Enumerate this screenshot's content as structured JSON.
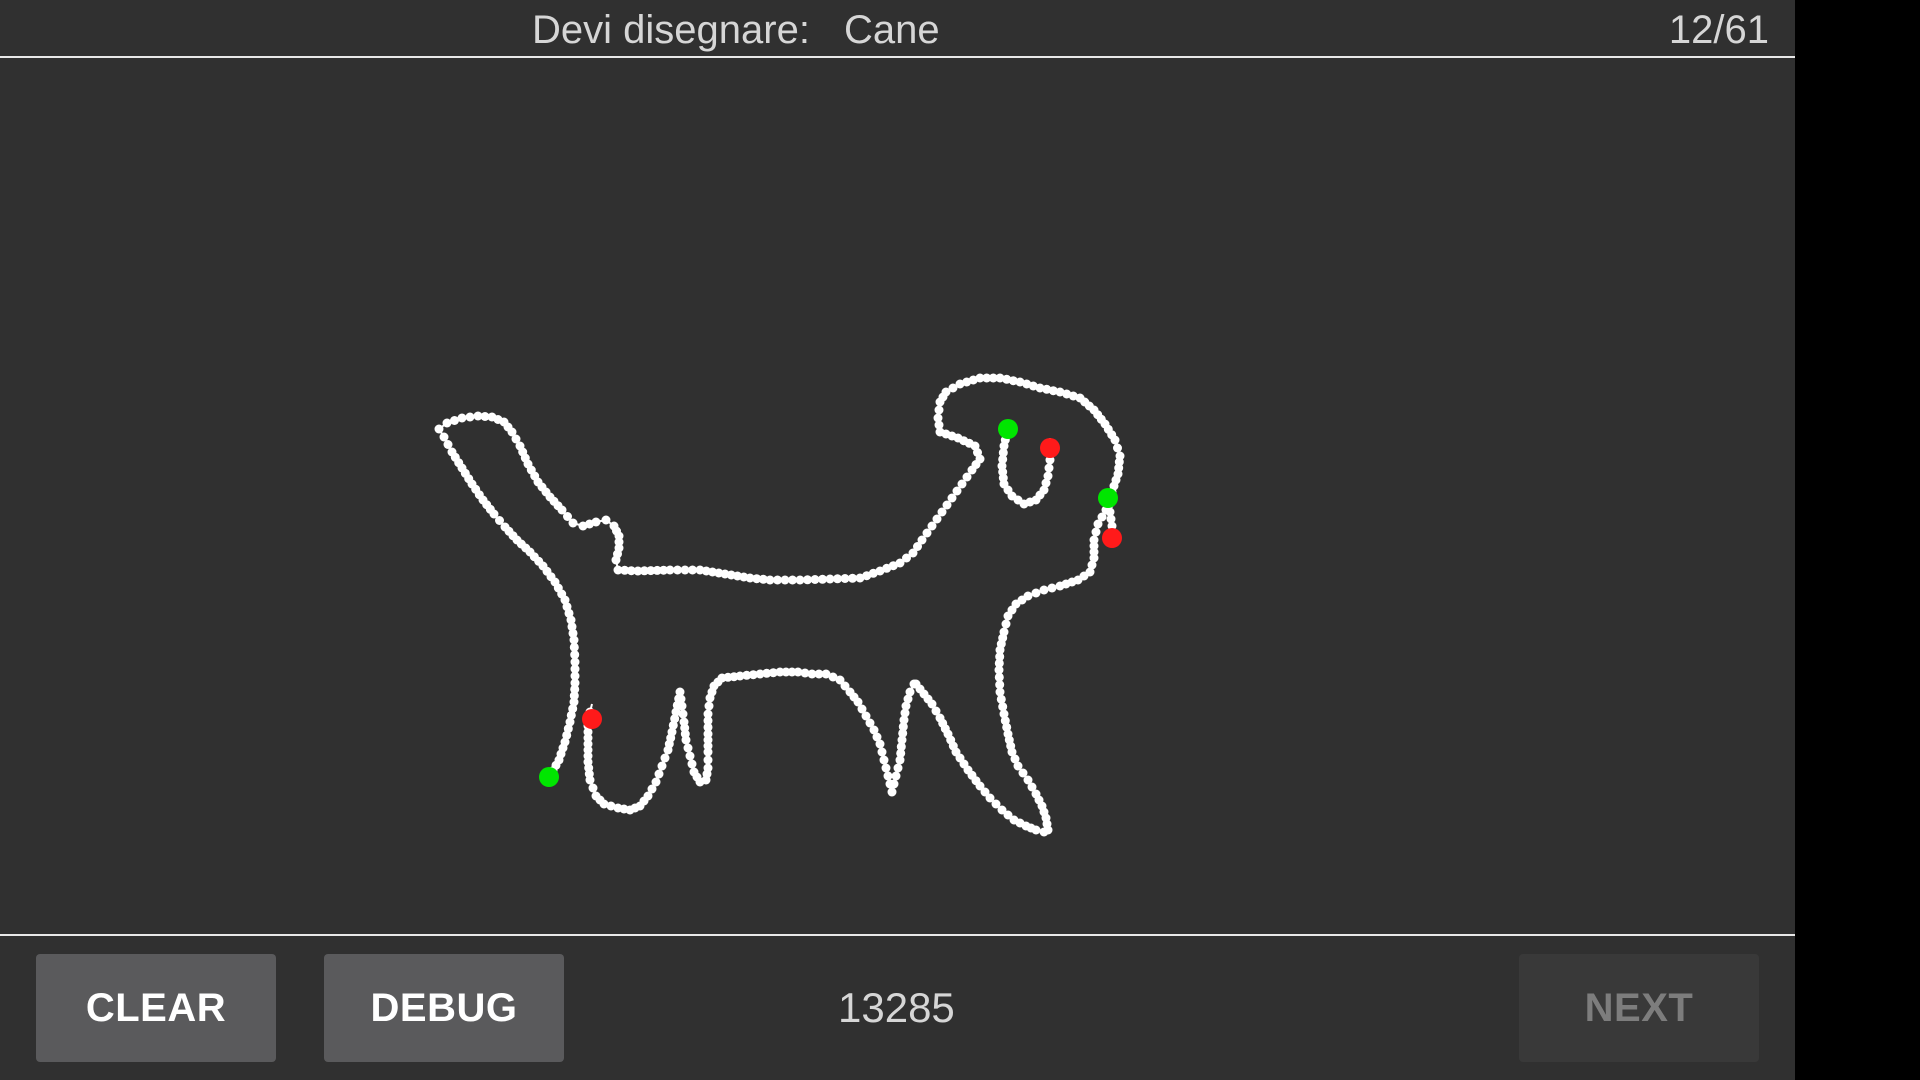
{
  "header": {
    "prompt_label": "Devi disegnare:",
    "target_word": "Cane",
    "progress": "12/61"
  },
  "canvas": {
    "stroke_color": "#ffffff",
    "start_marker_color": "#00e600",
    "end_marker_color": "#ff1a1a",
    "background": "#303030"
  },
  "footer": {
    "clear_label": "CLEAR",
    "debug_label": "DEBUG",
    "score": "13285",
    "next_label": "NEXT"
  }
}
